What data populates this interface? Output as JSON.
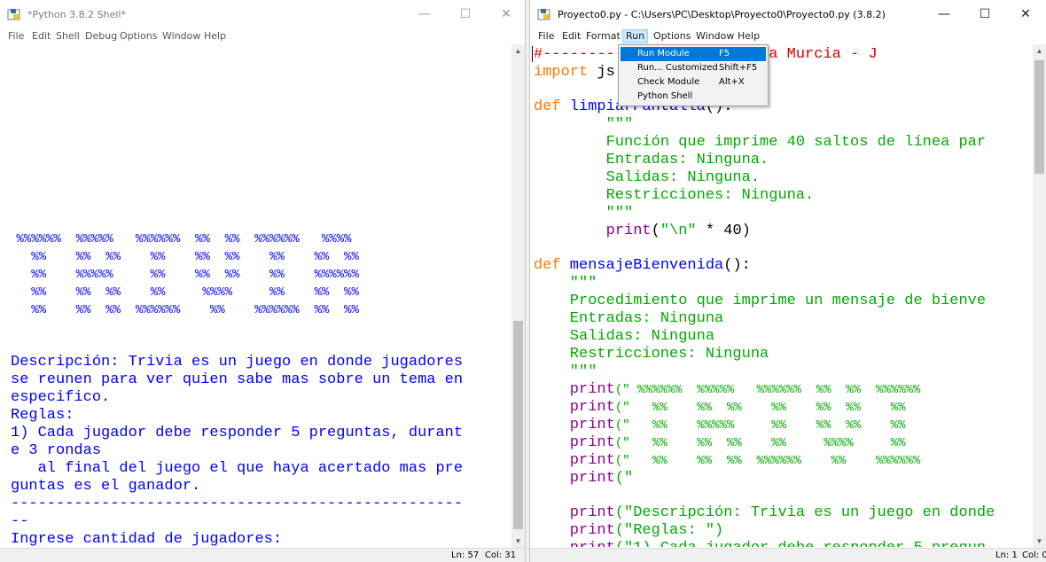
{
  "shell": {
    "title": "*Python 3.8.2 Shell*",
    "menu": [
      "File",
      "Edit",
      "Shell",
      "Debug",
      "Options",
      "Window",
      "Help"
    ],
    "banner_lines": [
      " %%%%%%  %%%%%   %%%%%%  %%  %%  %%%%%%   %%%%",
      "   %%    %%  %%    %%    %%  %%    %%    %%  %%",
      "   %%    %%%%%     %%    %%  %%    %%    %%%%%%",
      "   %%    %%  %%    %%     %%%%     %%    %%  %%",
      "   %%    %%  %%  %%%%%%    %%    %%%%%%  %%  %%"
    ],
    "text_lines": [
      "Descripción: Trivia es un juego en donde jugadores",
      "se reunen para ver quien sabe mas sobre un tema en",
      "especifico.",
      "Reglas:",
      "1) Cada jugador debe responder 5 preguntas, durant",
      "e 3 rondas",
      "   al final del juego el que haya acertado mas pre",
      "guntas es el ganador.",
      "--------------------------------------------------",
      "--",
      "Ingrese cantidad de jugadores:"
    ],
    "status": {
      "ln": "Ln: 57",
      "col": "Col: 31"
    },
    "window_buttons": {
      "minimize": "—",
      "maximize": "☐",
      "close": "✕"
    }
  },
  "editor": {
    "title": "Proyecto0.py - C:\\Users\\PC\\Desktop\\Proyecto0\\Proyecto0.py (3.8.2)",
    "menu": [
      "File",
      "Edit",
      "Format",
      "Run",
      "Options",
      "Window",
      "Help"
    ],
    "open_menu": "Run",
    "run_menu_items": [
      {
        "label": "Run Module",
        "accel": "F5",
        "highlighted": true
      },
      {
        "label": "Run... Customized",
        "accel": "Shift+F5",
        "highlighted": false
      },
      {
        "label": "Check Module",
        "accel": "Alt+X",
        "highlighted": false
      },
      {
        "label": "Python Shell",
        "accel": "",
        "highlighted": false
      }
    ],
    "code": {
      "l1_hash": "#-----------",
      "l1_comment": "- Michael Araya Murcia - J",
      "l2_kw": "import",
      "l2_rest": " js",
      "l4_kw": "def",
      "l4_name": " limpiarPantalla",
      "l4_rest": "():",
      "l5": "        \"\"\"",
      "l6": "        Función que imprime 40 saltos de línea par",
      "l7": "        Entradas: Ninguna.",
      "l8": "        Salidas: Ninguna.",
      "l9": "        Restricciones: Ninguna.",
      "l10": "        \"\"\"",
      "l11_fn": "        print",
      "l11_open": "(",
      "l11_str": "\"\\n\"",
      "l11_rest": " * 40)",
      "l13_kw": "def",
      "l13_name": " mensajeBienvenida",
      "l13_rest": "():",
      "l14": "    \"\"\"",
      "l15": "    Procedimiento que imprime un mensaje de bienve",
      "l16": "    Entradas: Ninguna",
      "l17": "    Salidas: Ninguna",
      "l18": "    Restricciones: Ninguna",
      "l19": "    \"\"\"",
      "p1": "(\" %%%%%%  %%%%%   %%%%%%  %%  %%  %%%%%%",
      "p2": "(\"   %%    %%  %%    %%    %%  %%    %%",
      "p3": "(\"   %%    %%%%%     %%    %%  %%    %%",
      "p4": "(\"   %%    %%  %%    %%     %%%%     %%",
      "p5": "(\"   %%    %%  %%  %%%%%%    %%    %%%%%%",
      "p6": "(\"",
      "print_kw": "    print",
      "d1": "(\"Descripción: Trivia es un juego en donde",
      "d2": "(\"Reglas: \")",
      "d3": "(\"1) Cada jugador debe responder 5 pregun"
    },
    "status": {
      "ln": "Ln: 1",
      "col": "Col: 0"
    },
    "window_buttons": {
      "minimize": "—",
      "maximize": "☐",
      "close": "✕"
    }
  },
  "colors": {
    "string": "#00aa00",
    "keyword": "#ff7700",
    "definition": "#0000ff",
    "comment": "#dd0000",
    "shell_output": "#0000ff",
    "menu_highlight": "#0078d7"
  }
}
